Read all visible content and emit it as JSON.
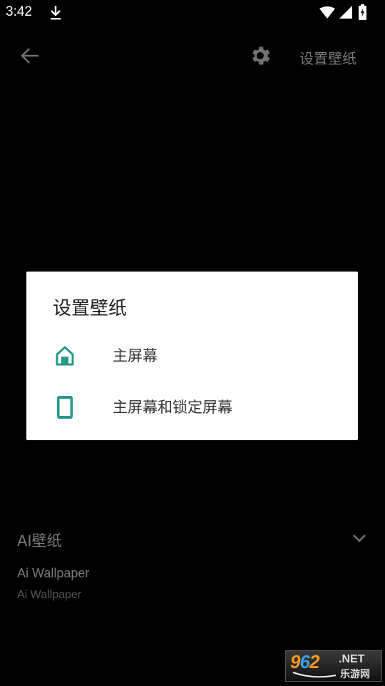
{
  "status_bar": {
    "time": "3:42",
    "icons": [
      "download-icon",
      "wifi-icon",
      "signal-icon",
      "battery-charging-icon"
    ]
  },
  "toolbar": {
    "back_icon": "arrow-left-icon",
    "settings_icon": "gear-icon",
    "action_label": "设置壁纸"
  },
  "dialog": {
    "title": "设置壁纸",
    "items": [
      {
        "icon": "home-icon",
        "label": "主屏幕"
      },
      {
        "icon": "phone-icon",
        "label": "主屏幕和锁定屏幕"
      }
    ],
    "accent_color": "#26998A"
  },
  "bottom": {
    "section_title": "AI壁纸",
    "chevron_icon": "chevron-down-icon",
    "pref_title": "Ai Wallpaper",
    "pref_summary": "Ai Wallpaper"
  },
  "watermark": {
    "digits": [
      "9",
      "6",
      "2"
    ],
    "suffix": ".NET",
    "cn_text": "乐游网"
  }
}
